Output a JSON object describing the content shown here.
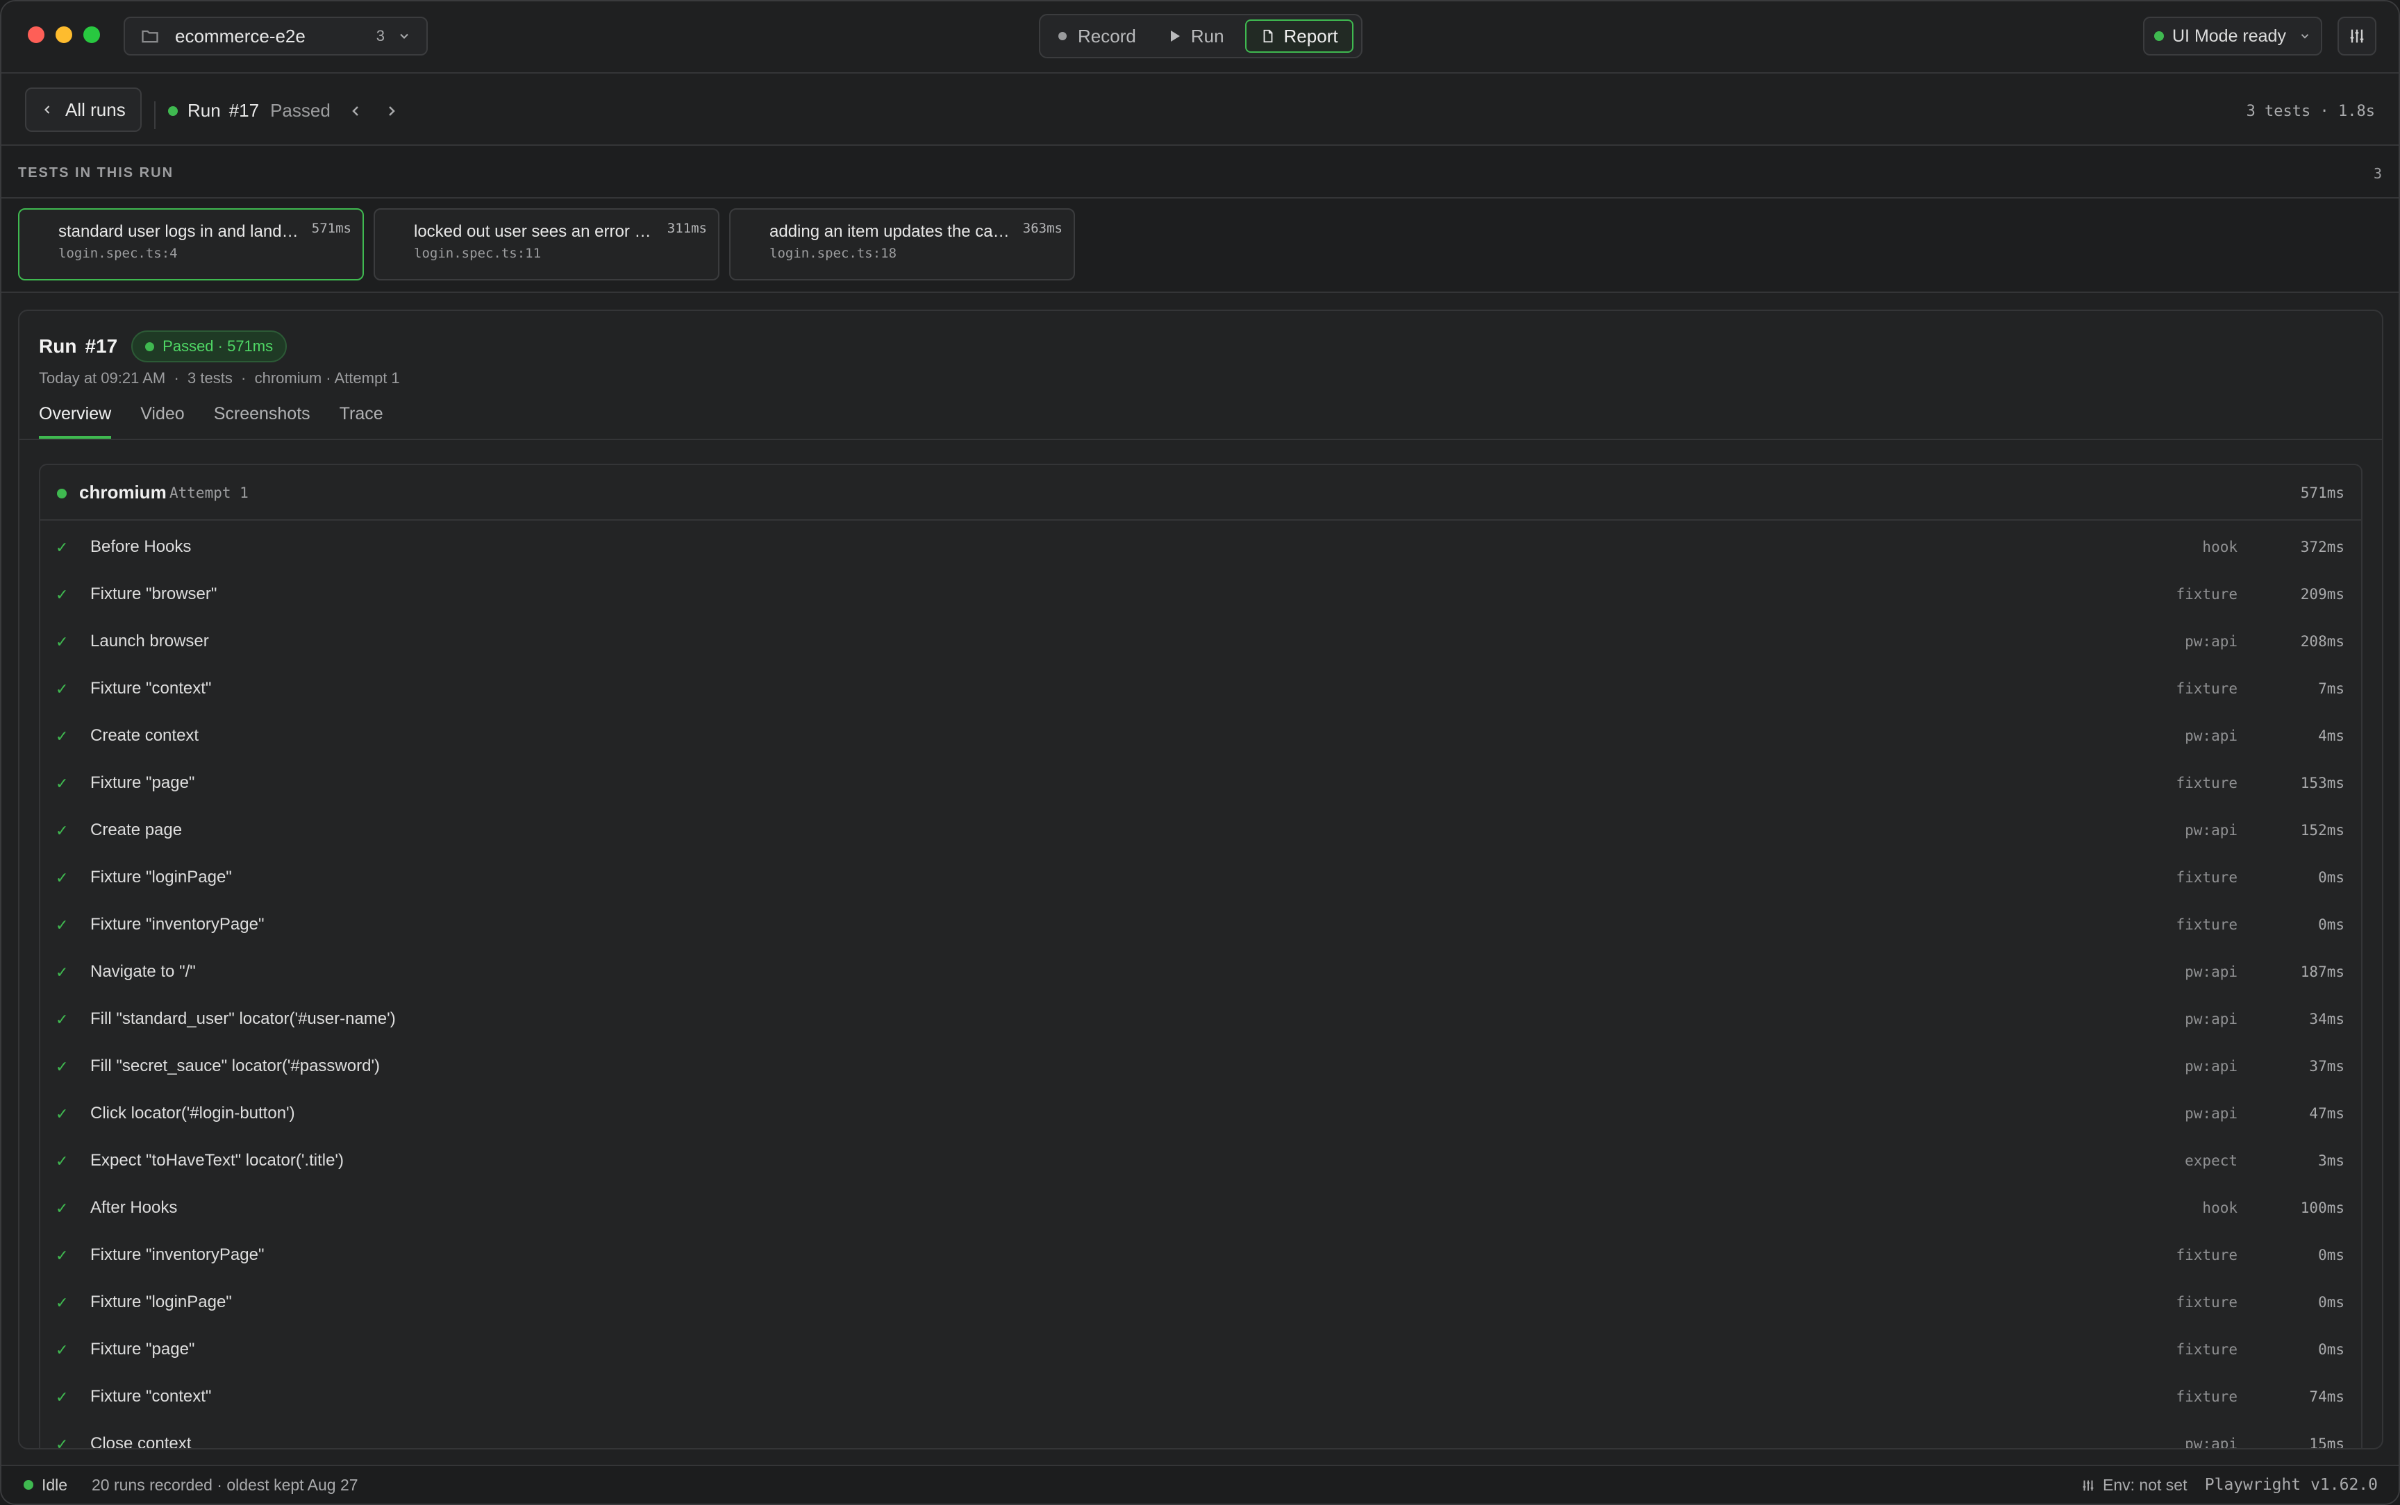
{
  "titlebar": {
    "project_name": "ecommerce-e2e",
    "project_count": "3",
    "modes": {
      "record": "Record",
      "run": "Run",
      "report": "Report"
    },
    "status": "UI Mode ready"
  },
  "runbar": {
    "all_runs": "All runs",
    "run_word": "Run",
    "run_number": "#17",
    "run_state": "Passed",
    "summary": "3 tests · 1.8s"
  },
  "tests_section": {
    "title": "TESTS IN THIS RUN",
    "count": "3",
    "tests": [
      {
        "name": "standard user logs in and lands on inventory",
        "file": "login.spec.ts:4",
        "duration": "571ms"
      },
      {
        "name": "locked out user sees an error message",
        "file": "login.spec.ts:11",
        "duration": "311ms"
      },
      {
        "name": "adding an item updates the cart badge",
        "file": "login.spec.ts:18",
        "duration": "363ms"
      }
    ]
  },
  "detail": {
    "run_word": "Run",
    "run_number": "#17",
    "badge": "Passed · 571ms",
    "meta": "Today at 09:21 AM  ·  3 tests  ·  chromium · Attempt 1",
    "tabs": [
      "Overview",
      "Video",
      "Screenshots",
      "Trace"
    ],
    "steps_head": {
      "browser": "chromium",
      "attempt": "Attempt 1",
      "total": "571ms"
    },
    "steps": [
      {
        "title": "Before Hooks",
        "kind": "hook",
        "duration": "372ms"
      },
      {
        "title": "Fixture \"browser\"",
        "kind": "fixture",
        "duration": "209ms"
      },
      {
        "title": "Launch browser",
        "kind": "pw:api",
        "duration": "208ms"
      },
      {
        "title": "Fixture \"context\"",
        "kind": "fixture",
        "duration": "7ms"
      },
      {
        "title": "Create context",
        "kind": "pw:api",
        "duration": "4ms"
      },
      {
        "title": "Fixture \"page\"",
        "kind": "fixture",
        "duration": "153ms"
      },
      {
        "title": "Create page",
        "kind": "pw:api",
        "duration": "152ms"
      },
      {
        "title": "Fixture \"loginPage\"",
        "kind": "fixture",
        "duration": "0ms"
      },
      {
        "title": "Fixture \"inventoryPage\"",
        "kind": "fixture",
        "duration": "0ms"
      },
      {
        "title": "Navigate to \"/\"",
        "kind": "pw:api",
        "duration": "187ms"
      },
      {
        "title": "Fill \"standard_user\" locator('#user-name')",
        "kind": "pw:api",
        "duration": "34ms"
      },
      {
        "title": "Fill \"secret_sauce\" locator('#password')",
        "kind": "pw:api",
        "duration": "37ms"
      },
      {
        "title": "Click locator('#login-button')",
        "kind": "pw:api",
        "duration": "47ms"
      },
      {
        "title": "Expect \"toHaveText\" locator('.title')",
        "kind": "expect",
        "duration": "3ms"
      },
      {
        "title": "After Hooks",
        "kind": "hook",
        "duration": "100ms"
      },
      {
        "title": "Fixture \"inventoryPage\"",
        "kind": "fixture",
        "duration": "0ms"
      },
      {
        "title": "Fixture \"loginPage\"",
        "kind": "fixture",
        "duration": "0ms"
      },
      {
        "title": "Fixture \"page\"",
        "kind": "fixture",
        "duration": "0ms"
      },
      {
        "title": "Fixture \"context\"",
        "kind": "fixture",
        "duration": "74ms"
      },
      {
        "title": "Close context",
        "kind": "pw:api",
        "duration": "15ms"
      }
    ]
  },
  "statusbar": {
    "state": "Idle",
    "runs": "20 runs recorded · oldest kept Aug 27",
    "env": "Env: not set",
    "version": "Playwright v1.62.0"
  },
  "colors": {
    "accent": "#3fb950",
    "background": "#202122"
  }
}
